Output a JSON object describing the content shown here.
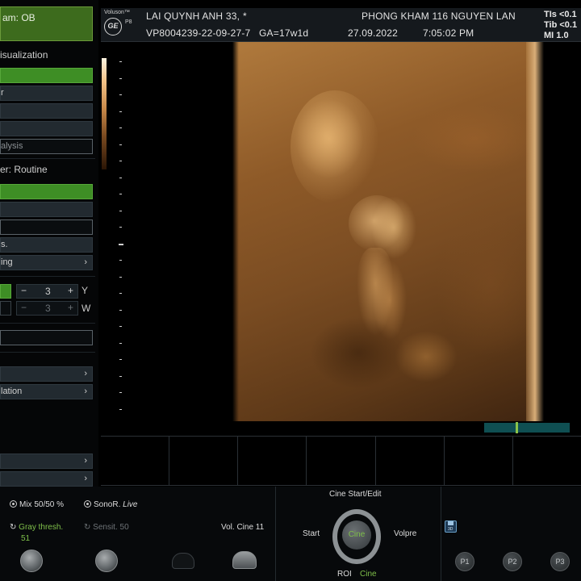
{
  "left_panel": {
    "exam": "am:  OB",
    "section_visualization": "isualization",
    "vis_buttons": [
      "",
      "r",
      "",
      "",
      "alysis"
    ],
    "section_render": "er: Routine",
    "render_buttons": [
      "",
      "",
      "",
      "s.",
      "ing"
    ],
    "stepper_y": {
      "minus": "−",
      "value": "3",
      "plus": "+",
      "axis": "Y"
    },
    "stepper_w": {
      "minus": "−",
      "value": "3",
      "plus": "+",
      "axis": "W"
    },
    "lower_buttons": [
      "",
      "",
      "lation",
      "",
      ""
    ]
  },
  "top_bar": {
    "logo_text": "Voluson™",
    "model": "P8",
    "ge": "GE",
    "patient_name": "LAI QUYNH ANH 33,",
    "star": "*",
    "patient_id": "VP8004239-22-09-27-7",
    "ga": "GA=17w1d",
    "clinic": "PHONG KHAM 116 NGUYEN LAN",
    "date": "27.09.2022",
    "time": "7:05:02 PM",
    "tis": "TIs <0.1",
    "tib": "Tib <0.1",
    "mi": "MI  1.0"
  },
  "bottom": {
    "mix": "Mix 50/50 %",
    "sonor": "SonoR.",
    "sonor_live": "Live",
    "gray_thresh": "Gray thresh.",
    "gray_thresh_value": "51",
    "sensit": "Sensit. 50",
    "vol_cine": "Vol. Cine 11",
    "cine_start_edit": "Cine Start/Edit",
    "start": "Start",
    "cine_center": "Cine",
    "volpre": "Volpre",
    "roi": "ROI",
    "roi_cine": "Cine",
    "save_3d": "3D",
    "p1": "P1",
    "p2": "P2",
    "p3": "P3"
  },
  "colors": {
    "accent_green": "#3e8e25",
    "label_green": "#7fc04a",
    "cine_bar": "#0f4f52"
  }
}
